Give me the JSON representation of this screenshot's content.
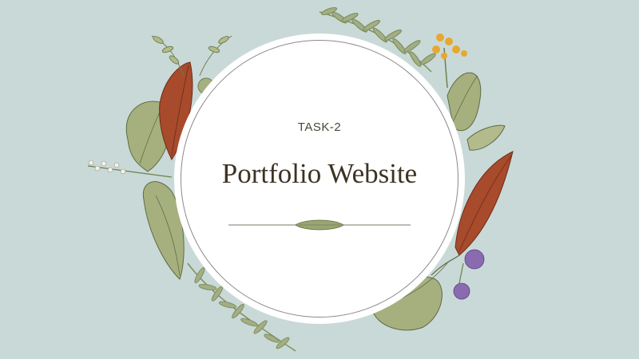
{
  "slide": {
    "subtitle": "TASK-2",
    "title": "Portfolio Website"
  },
  "colors": {
    "background": "#c9d9d8",
    "circle": "#ffffff",
    "text": "#3e3323",
    "leaf_green": "#a6b07f",
    "leaf_red": "#a84a2c",
    "fern": "#8a9a6e",
    "flower_yellow": "#e8a730",
    "flower_purple": "#8a6bb0"
  }
}
